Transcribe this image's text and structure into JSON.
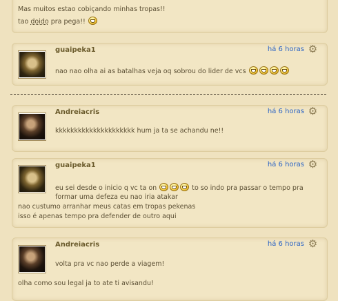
{
  "top_post": {
    "line1": "Mas muitos estao cobiçando minhas tropas!!",
    "line2_prefix": "tao ",
    "line2_link": "doido",
    "line2_suffix": " pra pega!!"
  },
  "comments": [
    {
      "author": "guaipeka1",
      "time": "há 6 horas",
      "lines": [
        "nao nao olha ai as batalhas veja oq sobrou do lider de vcs"
      ],
      "smileys": 4
    },
    {
      "author": "Andreiacris",
      "time": "há 6 horas",
      "lines": [
        "kkkkkkkkkkkkkkkkkkkkk hum ja ta se achandu ne!!"
      ]
    },
    {
      "author": "guaipeka1",
      "time": "há 6 horas",
      "line1_prefix": "eu sei desde o inicio q vc ta on",
      "line1_suffix": "to so indo pra passar o tempo pra",
      "line2": "formar uma defeza eu nao iria atakar",
      "line3": "nao custumo arranhar meus catas em tropas pekenas",
      "line4": "isso é apenas tempo pra defender de outro aqui",
      "smileys": 3
    },
    {
      "author": "Andreiacris",
      "time": "há 6 horas",
      "line1": "volta pra vc nao perde a viagem!",
      "line2": "olha como sou legal ja to ate ti avisandu!"
    }
  ],
  "icons": {
    "settings": "gear-icon",
    "emoticon": "grin-smiley-icon"
  }
}
